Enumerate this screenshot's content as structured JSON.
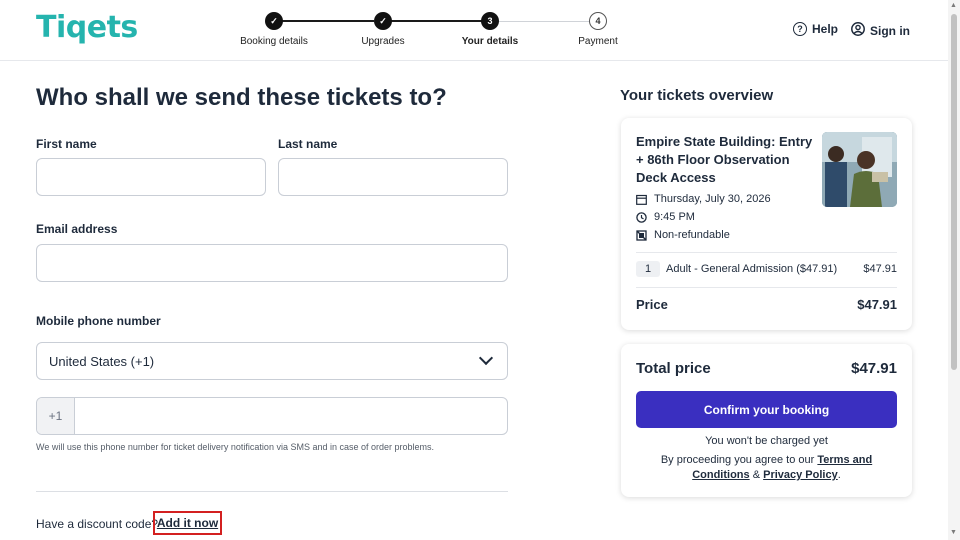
{
  "brand": {
    "logo_text": "Tiqets",
    "logo_color": "#25b4ae"
  },
  "steps": [
    {
      "label": "Booking details",
      "state": "done",
      "number": ""
    },
    {
      "label": "Upgrades",
      "state": "done",
      "number": ""
    },
    {
      "label": "Your details",
      "state": "current",
      "number": "3"
    },
    {
      "label": "Payment",
      "state": "upcoming",
      "number": "4"
    }
  ],
  "header": {
    "help_label": "Help",
    "signin_label": "Sign in"
  },
  "form": {
    "title": "Who shall we send these tickets to?",
    "first_name_label": "First name",
    "last_name_label": "Last name",
    "email_label": "Email address",
    "phone_label": "Mobile phone number",
    "country_selected": "United States (+1)",
    "phone_prefix": "+1",
    "phone_hint": "We will use this phone number for ticket delivery notification via SMS and in case of order problems.",
    "discount_text": "Have a discount code?",
    "discount_link": "Add it now"
  },
  "overview": {
    "title": "Your tickets overview",
    "product_title": "Empire State Building: Entry + 86th Floor Observation Deck Access",
    "date": "Thursday, July 30, 2026",
    "time": "9:45 PM",
    "refund_policy": "Non-refundable",
    "line_qty": "1",
    "line_desc": "Adult - General Admission ($47.91)",
    "line_price": "$47.91",
    "price_label": "Price",
    "price_value": "$47.91"
  },
  "checkout": {
    "total_label": "Total price",
    "total_value": "$47.91",
    "confirm_label": "Confirm your booking",
    "no_charge_text": "You won't be charged yet",
    "terms_prefix": "By proceeding you agree to our",
    "terms_link": "Terms and Conditions",
    "terms_and": "&",
    "privacy_link": "Privacy Policy",
    "terms_end": ".",
    "accent_color": "#3a2fc0"
  }
}
